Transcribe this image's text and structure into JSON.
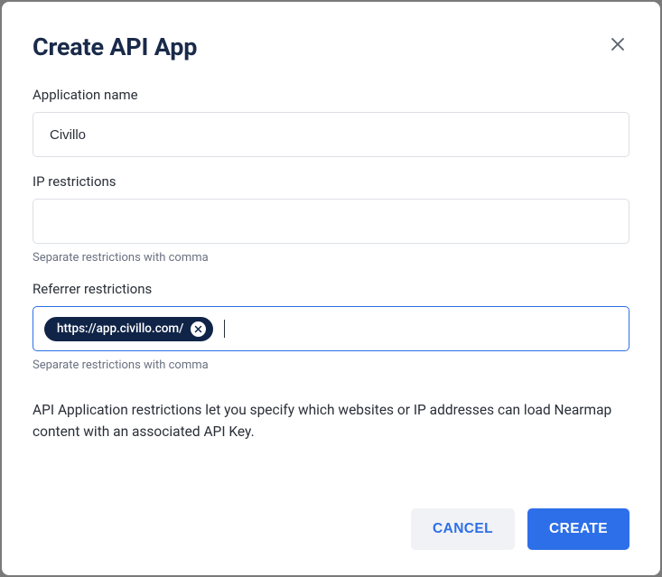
{
  "modal": {
    "title": "Create API App",
    "fields": {
      "appName": {
        "label": "Application name",
        "value": "Civillo"
      },
      "ipRestrictions": {
        "label": "IP restrictions",
        "value": "",
        "hint": "Separate restrictions with comma"
      },
      "referrerRestrictions": {
        "label": "Referrer restrictions",
        "chips": [
          "https://app.civillo.com/"
        ],
        "hint": "Separate restrictions with comma"
      }
    },
    "description": "API Application restrictions let you specify which websites or IP addresses can load Nearmap content with an associated API Key.",
    "buttons": {
      "cancel": "CANCEL",
      "create": "CREATE"
    }
  }
}
